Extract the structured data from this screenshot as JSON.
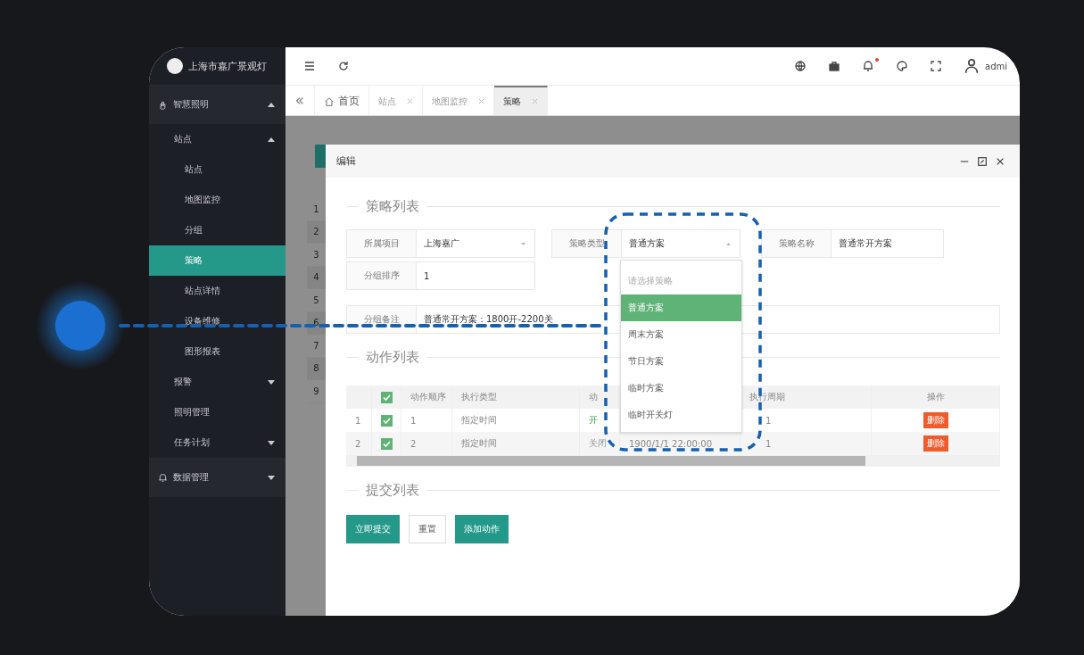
{
  "brand": {
    "title": "上海市嘉广景观灯"
  },
  "sidebar": {
    "items": [
      {
        "label": "智慧照明",
        "expanded": true,
        "selected": false,
        "children": [
          {
            "label": "站点",
            "expanded": true,
            "selected": false,
            "children": [
              {
                "label": "站点",
                "selected": false
              },
              {
                "label": "地图监控",
                "selected": false
              },
              {
                "label": "分组",
                "selected": false
              },
              {
                "label": "策略",
                "selected": true
              },
              {
                "label": "站点详情",
                "selected": false
              },
              {
                "label": "设备维修",
                "selected": false
              },
              {
                "label": "图形报表",
                "selected": false
              }
            ]
          },
          {
            "label": "报警",
            "expanded": false,
            "selected": false
          },
          {
            "label": "照明管理",
            "selected": false
          },
          {
            "label": "任务计划",
            "expanded": false,
            "selected": false
          }
        ]
      },
      {
        "label": "数据管理",
        "expanded": false,
        "selected": false
      }
    ]
  },
  "header": {
    "user": "admi",
    "notification_dot": true
  },
  "tabs": [
    {
      "label": "首页",
      "kind": "home",
      "selected": false
    },
    {
      "label": "站点",
      "kind": "page",
      "selected": false
    },
    {
      "label": "地图监控",
      "kind": "page",
      "selected": false
    },
    {
      "label": "策略",
      "kind": "page",
      "selected": true
    }
  ],
  "background_rows": [
    "1",
    "2",
    "3",
    "4",
    "5",
    "6",
    "7",
    "8",
    "9"
  ],
  "dialog": {
    "title": "编辑",
    "sections": [
      "策略列表",
      "动作列表",
      "提交列表"
    ],
    "fields": [
      {
        "label": "所属项目",
        "value": "上海嘉广",
        "kind": "select"
      },
      {
        "label": "策略类型",
        "value": "普通方案",
        "kind": "select-open"
      },
      {
        "label": "策略名称",
        "value": "普通常开方案",
        "kind": "text"
      },
      {
        "label": "分组排序",
        "value": "1",
        "kind": "text"
      },
      {
        "label": "分组备注",
        "value": "普通常开方案：1800开-2200关",
        "kind": "wide"
      }
    ],
    "dropdown": [
      {
        "label": "请选择策略",
        "placeholder": true,
        "selected": false
      },
      {
        "label": "普通方案",
        "placeholder": false,
        "selected": true
      },
      {
        "label": "周末方案",
        "placeholder": false,
        "selected": false
      },
      {
        "label": "节日方案",
        "placeholder": false,
        "selected": false
      },
      {
        "label": "临时方案",
        "placeholder": false,
        "selected": false
      },
      {
        "label": "临时开关灯",
        "placeholder": false,
        "selected": false
      }
    ],
    "table": {
      "all_checked": true,
      "columns": [
        "动作顺序",
        "执行类型",
        "动",
        "执行周期",
        "操作"
      ],
      "rows": [
        {
          "index": "1",
          "checked": true,
          "order": "1",
          "type": "指定时间",
          "action": "开",
          "kind": "on",
          "cycle": "1",
          "delete": "删除"
        },
        {
          "index": "2",
          "checked": true,
          "order": "2",
          "type": "指定时间",
          "action": "关闭",
          "kind": "off",
          "time": "1900/1/1 22:00:00",
          "cycle": "1",
          "delete": "删除"
        }
      ]
    },
    "buttons": [
      {
        "label": "立即提交",
        "kind": "primary"
      },
      {
        "label": "重置",
        "kind": "plain"
      },
      {
        "label": "添加动作",
        "kind": "primary"
      }
    ]
  }
}
